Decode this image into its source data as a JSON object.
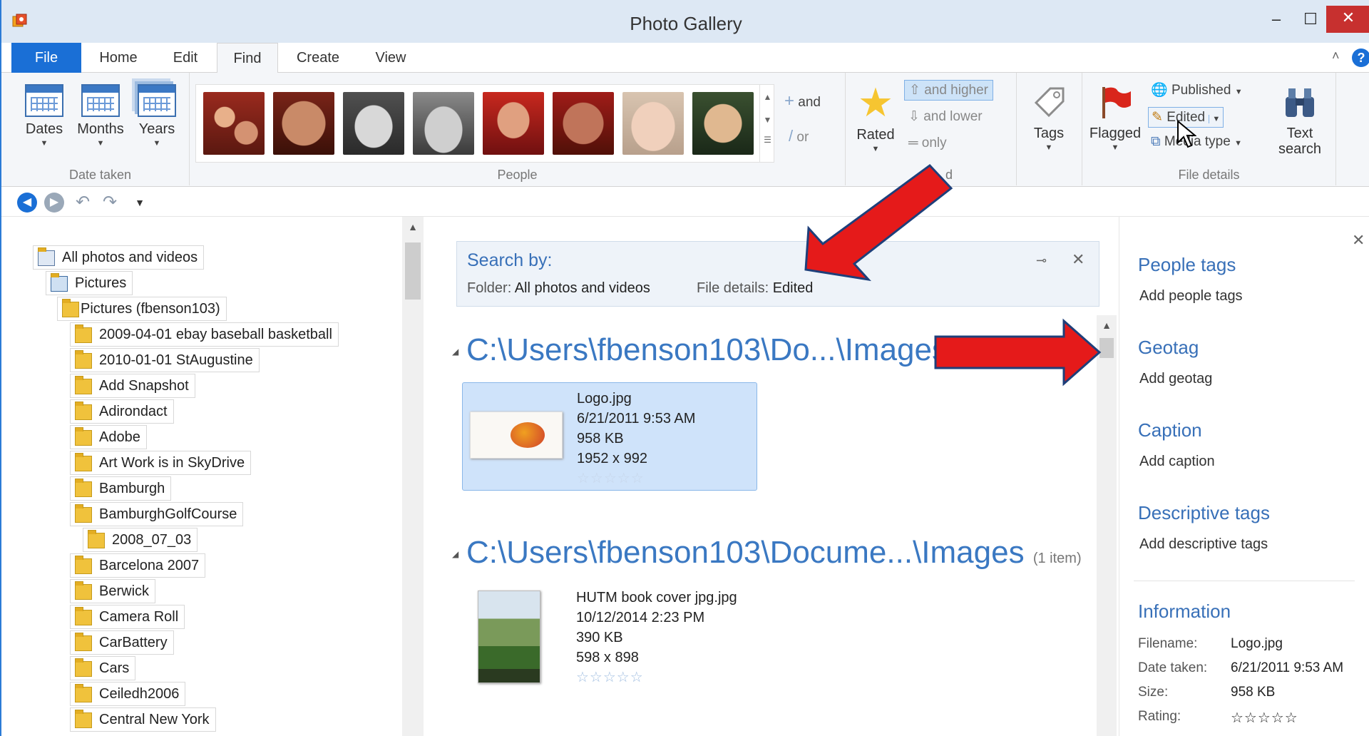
{
  "window": {
    "title": "Photo Gallery"
  },
  "tabs": [
    "File",
    "Home",
    "Edit",
    "Find",
    "Create",
    "View"
  ],
  "ribbon": {
    "date_taken": {
      "buttons": [
        "Dates",
        "Months",
        "Years"
      ],
      "label": "Date taken"
    },
    "people": {
      "label": "People",
      "and": "and",
      "or": "or"
    },
    "rating": {
      "rated": "Rated",
      "and_higher": "and higher",
      "and_lower": "and lower",
      "only": "only",
      "label_fragment": "d"
    },
    "tags": "Tags",
    "file_details": {
      "flagged": "Flagged",
      "published": "Published",
      "edited": "Edited",
      "media_type": "Media type",
      "label": "File details"
    },
    "text_search": {
      "line1": "Text",
      "line2": "search"
    }
  },
  "tree": {
    "root": "All photos and videos",
    "pictures": "Pictures",
    "user_pictures": "Pictures (fbenson103)",
    "folders": [
      "2009-04-01 ebay baseball basketball",
      "2010-01-01 StAugustine",
      "Add Snapshot",
      "Adirondact",
      "Adobe",
      "Art Work is in SkyDrive",
      "Bamburgh",
      "BamburghGolfCourse",
      "2008_07_03",
      "Barcelona 2007",
      "Berwick",
      "Camera Roll",
      "CarBattery",
      "Cars",
      "Ceiledh2006",
      "Central New York"
    ]
  },
  "search": {
    "title": "Search by:",
    "folder_label": "Folder:",
    "folder_value": "All photos and videos",
    "details_label": "File details:",
    "details_value": "Edited"
  },
  "groups": [
    {
      "path": "C:\\Users\\fbenson103\\Do...\\Images",
      "count": "",
      "item": {
        "name": "Logo.jpg",
        "date": "6/21/2011 9:53 AM",
        "size": "958 KB",
        "dims": "1952 x 992",
        "stars": "☆☆☆☆☆"
      }
    },
    {
      "path": "C:\\Users\\fbenson103\\Docume...\\Images",
      "count": "(1 item)",
      "item": {
        "name": "HUTM book cover jpg.jpg",
        "date": "10/12/2014 2:23 PM",
        "size": "390 KB",
        "dims": "598 x 898",
        "stars": "☆☆☆☆☆"
      }
    }
  ],
  "info_pane": {
    "people_tags": "People tags",
    "add_people_tags": "Add people tags",
    "geotag": "Geotag",
    "add_geotag": "Add geotag",
    "caption": "Caption",
    "add_caption": "Add caption",
    "descriptive_tags": "Descriptive tags",
    "add_descriptive_tags": "Add descriptive tags",
    "information": "Information",
    "rows": [
      {
        "label": "Filename:",
        "value": "Logo.jpg"
      },
      {
        "label": "Date taken:",
        "value": "6/21/2011  9:53 AM"
      },
      {
        "label": "Size:",
        "value": "958 KB"
      },
      {
        "label": "Rating:",
        "value": "☆☆☆☆☆"
      }
    ]
  },
  "colors": {
    "accent": "#1a6fd6",
    "heading": "#3a78c2",
    "selected": "#cfe3fa",
    "arrow": "#e51a1a"
  }
}
